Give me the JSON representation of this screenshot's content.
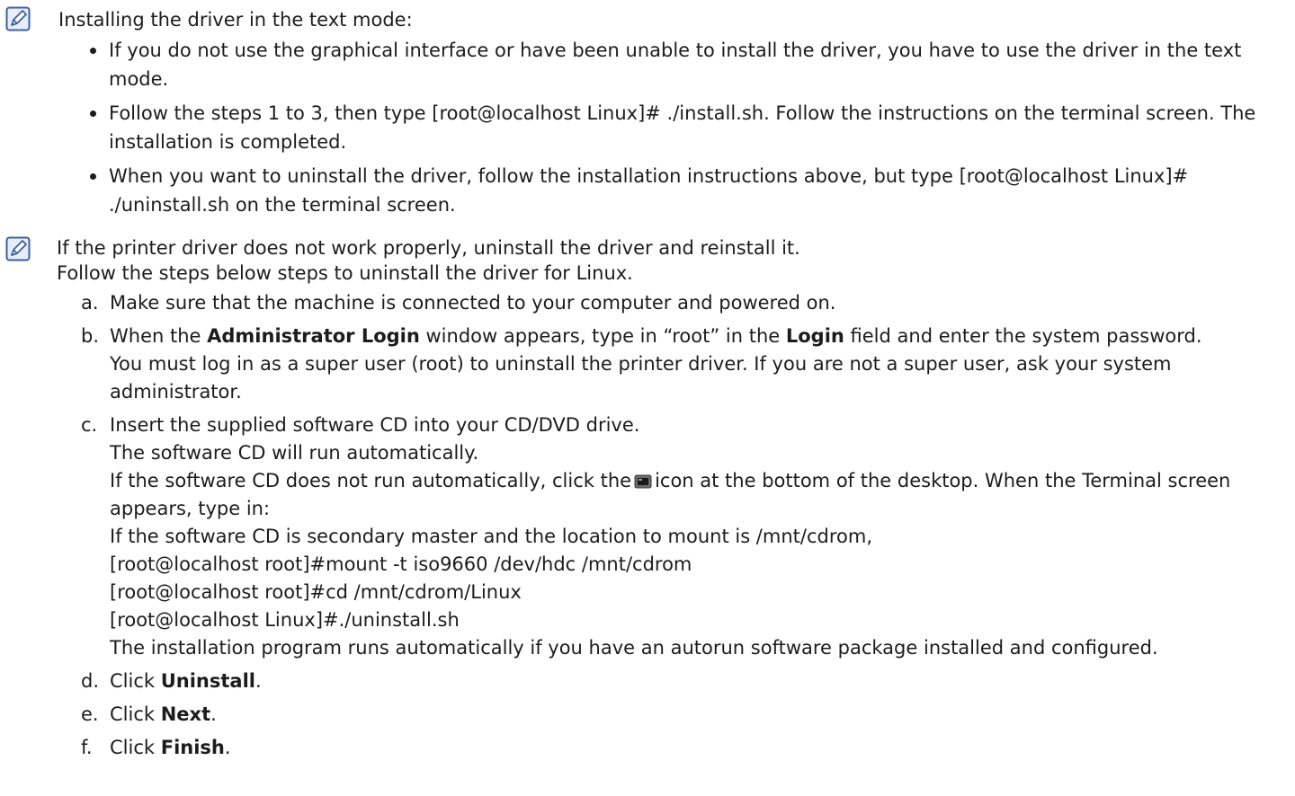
{
  "note1": {
    "icon": "note-pencil-icon",
    "title": "Installing the driver in the text mode:",
    "items": [
      "If you do not use the graphical interface or have been unable to install the driver, you have to use the driver in the text mode.",
      "Follow the steps 1 to 3, then type [root@localhost Linux]# ./install.sh. Follow the instructions on the terminal screen. The installation is completed.",
      "When you want to uninstall the driver, follow the installation instructions above, but type [root@localhost Linux]# ./uninstall.sh on the terminal screen."
    ]
  },
  "note2": {
    "icon": "note-pencil-icon",
    "line1": "If the printer driver does not work properly, uninstall the driver and reinstall it.",
    "line2": "Follow the steps below steps to uninstall the driver for Linux."
  },
  "steps": {
    "a": {
      "letter": "a.",
      "text": "Make sure that the machine is connected to your computer and powered on."
    },
    "b": {
      "letter": "b.",
      "pre": "When the ",
      "bold1": "Administrator Login",
      "mid": " window appears, type in “root” in the ",
      "bold2": "Login",
      "post": " field and enter the system password.",
      "line2": "You must log in as a super user (root) to uninstall the printer driver. If you are not a super user, ask your system administrator."
    },
    "c": {
      "letter": "c.",
      "line1": "Insert the supplied software CD into your CD/DVD drive.",
      "line2": "The software CD will run automatically.",
      "line3_pre": "If the software CD does not run automatically, click the",
      "line3_icon": "terminal-icon",
      "line3_post": "icon at the bottom of the desktop. When the Terminal screen appears, type in:",
      "line4": "If the software CD is secondary master and the location to mount is /mnt/cdrom,",
      "line5": "[root@localhost root]#mount -t iso9660 /dev/hdc /mnt/cdrom",
      "line6": "[root@localhost root]#cd /mnt/cdrom/Linux",
      "line7": "[root@localhost Linux]#./uninstall.sh",
      "line8": "The installation program runs automatically if you have an autorun software package installed and configured."
    },
    "d": {
      "letter": "d.",
      "pre": "Click ",
      "bold": "Uninstall",
      "post": "."
    },
    "e": {
      "letter": "e.",
      "pre": "Click ",
      "bold": "Next",
      "post": "."
    },
    "f": {
      "letter": "f.",
      "pre": "Click ",
      "bold": "Finish",
      "post": "."
    }
  }
}
